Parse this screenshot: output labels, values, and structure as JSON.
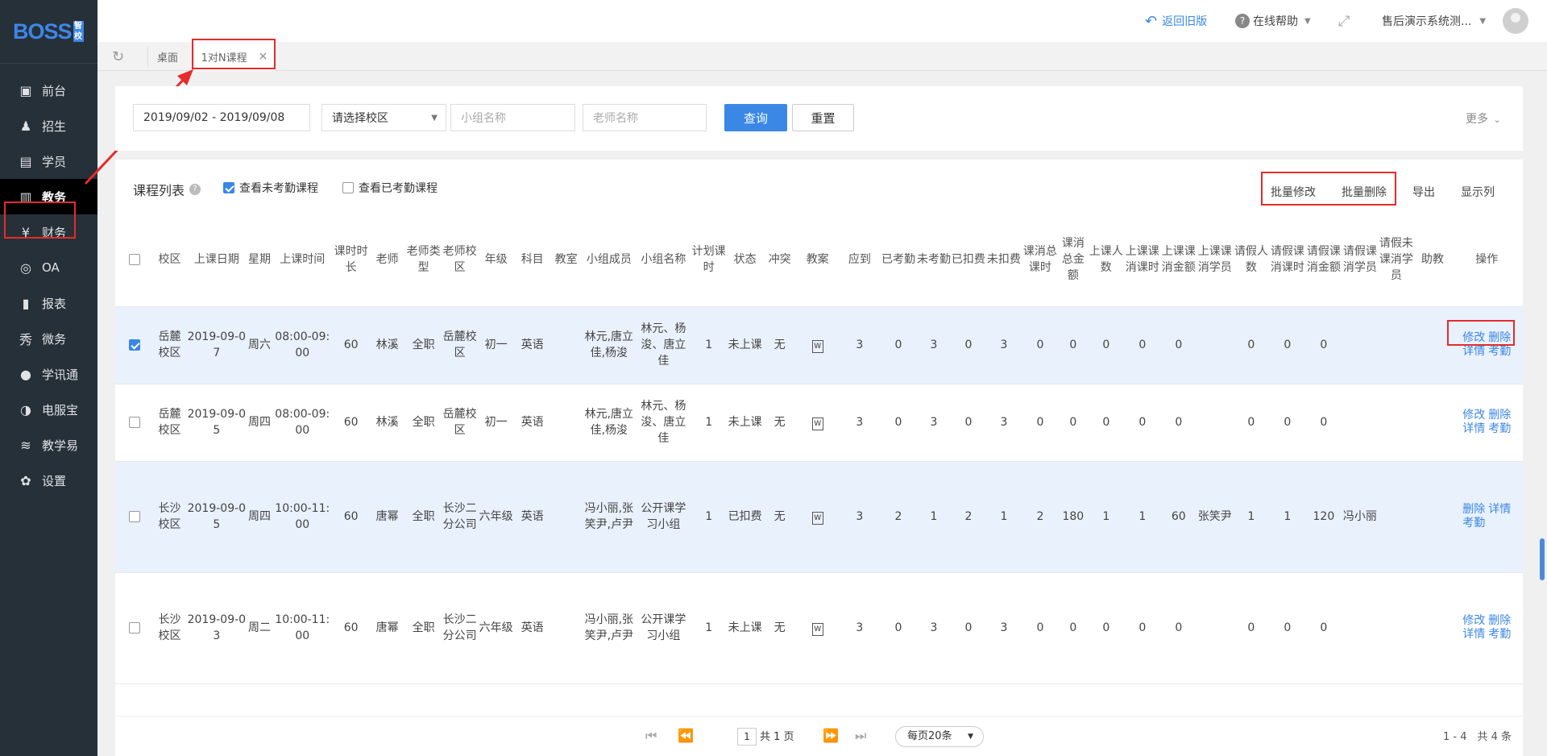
{
  "logo": {
    "text": "BOSS",
    "badge": "智校"
  },
  "sidebar": {
    "items": [
      {
        "label": "前台",
        "icon": "calendar-icon",
        "glyph": "▣"
      },
      {
        "label": "招生",
        "icon": "user-plus-icon",
        "glyph": "♟"
      },
      {
        "label": "学员",
        "icon": "student-icon",
        "glyph": "▤"
      },
      {
        "label": "教务",
        "icon": "book-icon",
        "glyph": "▥"
      },
      {
        "label": "财务",
        "icon": "money-icon",
        "glyph": "¥"
      },
      {
        "label": "OA",
        "icon": "oa-icon",
        "glyph": "◎"
      },
      {
        "label": "报表",
        "icon": "chart-icon",
        "glyph": "▮"
      },
      {
        "label": "微务",
        "icon": "wechat-icon",
        "glyph": "秀"
      },
      {
        "label": "学讯通",
        "icon": "location-icon",
        "glyph": "●"
      },
      {
        "label": "电服宝",
        "icon": "phone-service-icon",
        "glyph": "◑"
      },
      {
        "label": "教学易",
        "icon": "teaching-icon",
        "glyph": "≋"
      },
      {
        "label": "设置",
        "icon": "gear-icon",
        "glyph": "✿"
      }
    ]
  },
  "topbar": {
    "back_old": "返回旧版",
    "help": "在线帮助",
    "user": "售后演示系统测...",
    "back_icon": "↶",
    "help_icon": "?",
    "expand_icon": "⤢"
  },
  "tabs": {
    "desk": "桌面",
    "current": "1对N课程",
    "close": "×"
  },
  "filter": {
    "date_range": "2019/09/02 - 2019/09/08",
    "campus_placeholder": "请选择校区",
    "group_placeholder": "小组名称",
    "teacher_placeholder": "老师名称",
    "query": "查询",
    "reset": "重置",
    "more": "更多"
  },
  "list": {
    "title": "课程列表",
    "cb_unchecked_attendance": "查看未考勤课程",
    "cb_checked_attendance": "查看已考勤课程",
    "batch_edit": "批量修改",
    "batch_delete": "批量删除",
    "export": "导出",
    "columns_btn": "显示列"
  },
  "table": {
    "headers": [
      "校区",
      "上课日期",
      "星期",
      "上课时间",
      "课时时长",
      "老师",
      "老师类型",
      "老师校区",
      "年级",
      "科目",
      "教室",
      "小组成员",
      "小组名称",
      "计划课时",
      "状态",
      "冲突",
      "教案",
      "应到",
      "已考勤",
      "未考勤",
      "已扣费",
      "未扣费",
      "课消总课时",
      "课消总金额",
      "上课人数",
      "上课课消课时",
      "上课课消金额",
      "上课课消学员",
      "请假人数",
      "请假课消课时",
      "请假课消金额",
      "请假课消学员",
      "请假未课消学员",
      "助教",
      "操作"
    ],
    "rows": [
      {
        "campus": "岳麓校区",
        "date": "2019-09-07",
        "week": "周六",
        "time": "08:00-09:00",
        "dur": "60",
        "teacher": "林溪",
        "ttype": "全职",
        "tcampus": "岳麓校区",
        "grade": "初一",
        "subject": "英语",
        "room": "",
        "members": "林元,唐立佳,杨浚",
        "group": "林元、杨浚、唐立佳",
        "plan": "1",
        "status": "未上课",
        "conflict": "无",
        "due": "3",
        "att": "0",
        "unatt": "3",
        "ded": "0",
        "unded": "3",
        "tot_h": "0",
        "tot_amt": "0",
        "cls_n": "0",
        "cls_h": "0",
        "cls_amt": "0",
        "cls_stu": "",
        "lv_n": "0",
        "lv_h": "0",
        "lv_amt": "0",
        "lv_stu": "",
        "lv_un": "",
        "assist": "",
        "ops": [
          "修改",
          "删除",
          "详情",
          "考勤"
        ]
      },
      {
        "campus": "岳麓校区",
        "date": "2019-09-05",
        "week": "周四",
        "time": "08:00-09:00",
        "dur": "60",
        "teacher": "林溪",
        "ttype": "全职",
        "tcampus": "岳麓校区",
        "grade": "初一",
        "subject": "英语",
        "room": "",
        "members": "林元,唐立佳,杨浚",
        "group": "林元、杨浚、唐立佳",
        "plan": "1",
        "status": "未上课",
        "conflict": "无",
        "due": "3",
        "att": "0",
        "unatt": "3",
        "ded": "0",
        "unded": "3",
        "tot_h": "0",
        "tot_amt": "0",
        "cls_n": "0",
        "cls_h": "0",
        "cls_amt": "0",
        "cls_stu": "",
        "lv_n": "0",
        "lv_h": "0",
        "lv_amt": "0",
        "lv_stu": "",
        "lv_un": "",
        "assist": "",
        "ops": [
          "修改",
          "删除",
          "详情",
          "考勤"
        ]
      },
      {
        "campus": "长沙校区",
        "date": "2019-09-05",
        "week": "周四",
        "time": "10:00-11:00",
        "dur": "60",
        "teacher": "唐幂",
        "ttype": "全职",
        "tcampus": "长沙二分公司",
        "grade": "六年级",
        "subject": "英语",
        "room": "",
        "members": "冯小丽,张笑尹,卢尹",
        "group": "公开课学习小组",
        "plan": "1",
        "status": "已扣费",
        "conflict": "无",
        "due": "3",
        "att": "2",
        "unatt": "1",
        "ded": "2",
        "unded": "1",
        "tot_h": "2",
        "tot_amt": "180",
        "cls_n": "1",
        "cls_h": "1",
        "cls_amt": "60",
        "cls_stu": "张笑尹",
        "lv_n": "1",
        "lv_h": "1",
        "lv_amt": "120",
        "lv_stu": "冯小丽",
        "lv_un": "",
        "assist": "",
        "ops": [
          "删除",
          "详情",
          "考勤"
        ]
      },
      {
        "campus": "长沙校区",
        "date": "2019-09-03",
        "week": "周二",
        "time": "10:00-11:00",
        "dur": "60",
        "teacher": "唐幂",
        "ttype": "全职",
        "tcampus": "长沙二分公司",
        "grade": "六年级",
        "subject": "英语",
        "room": "",
        "members": "冯小丽,张笑尹,卢尹",
        "group": "公开课学习小组",
        "plan": "1",
        "status": "未上课",
        "conflict": "无",
        "due": "3",
        "att": "0",
        "unatt": "3",
        "ded": "0",
        "unded": "3",
        "tot_h": "0",
        "tot_amt": "0",
        "cls_n": "0",
        "cls_h": "0",
        "cls_amt": "0",
        "cls_stu": "",
        "lv_n": "0",
        "lv_h": "0",
        "lv_amt": "0",
        "lv_stu": "",
        "lv_un": "",
        "assist": "",
        "ops": [
          "修改",
          "删除",
          "详情",
          "考勤"
        ]
      }
    ]
  },
  "pager": {
    "first": "⏮",
    "prev": "⏪",
    "next": "⏩",
    "last": "⏭",
    "page": "1",
    "total_pages": "共 1 页",
    "per_page": "每页20条",
    "summary": "1 - 4　共 4 条"
  },
  "colors": {
    "accent": "#3a87e6",
    "annotation": "#e52b2b",
    "sidebar": "#263038"
  }
}
